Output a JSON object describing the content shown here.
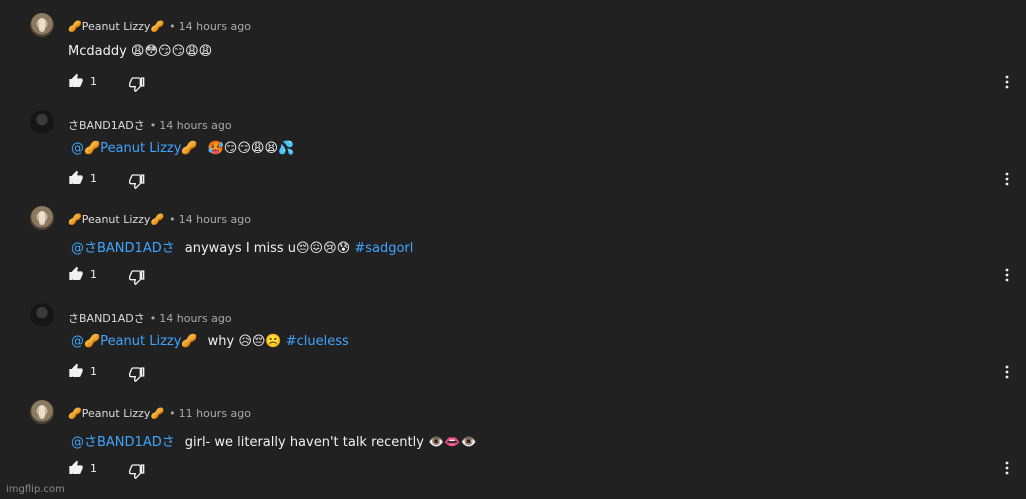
{
  "comments": [
    {
      "author": "🥜Peanut Lizzy🥜",
      "time": "14 hours ago",
      "mention": "",
      "body": "Mcdaddy 😩😳😏😏😩😩",
      "tag": "",
      "likes": "1",
      "avatar": "peanut"
    },
    {
      "author": "さBAND1ADさ",
      "time": "14 hours ago",
      "mention": "@🥜Peanut Lizzy🥜",
      "body": "🥵😏😏😩😫💦",
      "tag": "",
      "likes": "1",
      "avatar": "band"
    },
    {
      "author": "🥜Peanut Lizzy🥜",
      "time": "14 hours ago",
      "mention": "@さBAND1ADさ",
      "body": "anyways I miss u😔😖😢😰",
      "tag": "#sadgorl",
      "likes": "1",
      "avatar": "peanut"
    },
    {
      "author": "さBAND1ADさ",
      "time": "14 hours ago",
      "mention": "@🥜Peanut Lizzy🥜",
      "body": "why 😥😔☹️",
      "tag": "#clueless",
      "likes": "1",
      "avatar": "band"
    },
    {
      "author": "🥜Peanut Lizzy🥜",
      "time": "11 hours ago",
      "mention": "@さBAND1ADさ",
      "body": "girl- we literally haven't talk recently 👁️👄👁️",
      "tag": "",
      "likes": "1",
      "avatar": "peanut"
    }
  ],
  "icons": {
    "like": "thumbs-up-icon",
    "dislike": "thumbs-down-icon",
    "menu": "more-vert-icon"
  },
  "colors": {
    "background": "#212121",
    "link": "#3ea6ff",
    "meta": "#aaaaaa"
  },
  "footer": {
    "watermark": "imgflip.com"
  }
}
